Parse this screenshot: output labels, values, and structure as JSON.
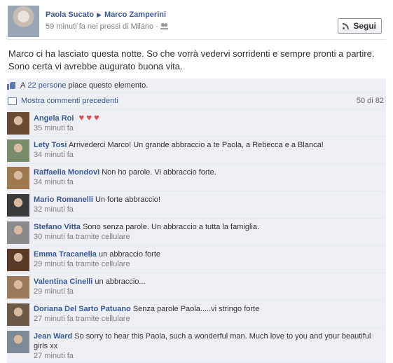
{
  "post": {
    "author": "Paola Sucato",
    "target": "Marco Zamperini",
    "meta": "59 minuti fa nei pressi di Milano ·",
    "follow_label": "Segui",
    "text": "Marco ci ha lasciato questa notte. So che vorrà vedervi sorridenti e sempre pronti a partire. Sono certa vi avrebbe augurato buona vita."
  },
  "likes": {
    "prefix": "A",
    "link": "22 persone",
    "suffix": "piace questo elemento."
  },
  "more_comments": {
    "label": "Mostra commenti precedenti",
    "count": "50 di 82"
  },
  "comments": [
    {
      "name": "Angela Roi",
      "text": "",
      "hearts": "♥♥♥",
      "time": "35 minuti fa",
      "avatar_color": "#6b4a32"
    },
    {
      "name": "Lety Tosi",
      "text": "Arrivederci Marco! Un grande abbraccio a te Paola, a Rebecca e a Blanca!",
      "time": "34 minuti fa",
      "avatar_color": "#7a8b6c"
    },
    {
      "name": "Raffaella Mondovì",
      "text": "Non ho parole. Vi abbraccio forte.",
      "time": "34 minuti fa",
      "avatar_color": "#a07850"
    },
    {
      "name": "Mario Romanelli",
      "text": "Un forte abbraccio!",
      "time": "32 minuti fa",
      "avatar_color": "#3a3a3a"
    },
    {
      "name": "Stefano Vitta",
      "text": "Sono senza parole. Un abbraccio a tutta la famiglia.",
      "time": "30 minuti fa tramite cellulare",
      "avatar_color": "#8a8a8a"
    },
    {
      "name": "Emma Tracanella",
      "text": "un abbraccio forte",
      "time": "29 minuti fa tramite cellulare",
      "avatar_color": "#5a3a28"
    },
    {
      "name": "Valentina Cinelli",
      "text": "un abbraccio...",
      "time": "29 minuti fa",
      "avatar_color": "#9b7a5c"
    },
    {
      "name": "Doriana Del Sarto Patuano",
      "text": "Senza parole Paola.....vi stringo forte",
      "time": "27 minuti fa tramite cellulare",
      "avatar_color": "#6c5a48"
    },
    {
      "name": "Jean Ward",
      "text": "So sorry to hear this Paola, such a wonderful man. Much love to you and your beautiful girls xx",
      "time": "27 minuti fa",
      "avatar_color": "#7d8a96"
    }
  ]
}
